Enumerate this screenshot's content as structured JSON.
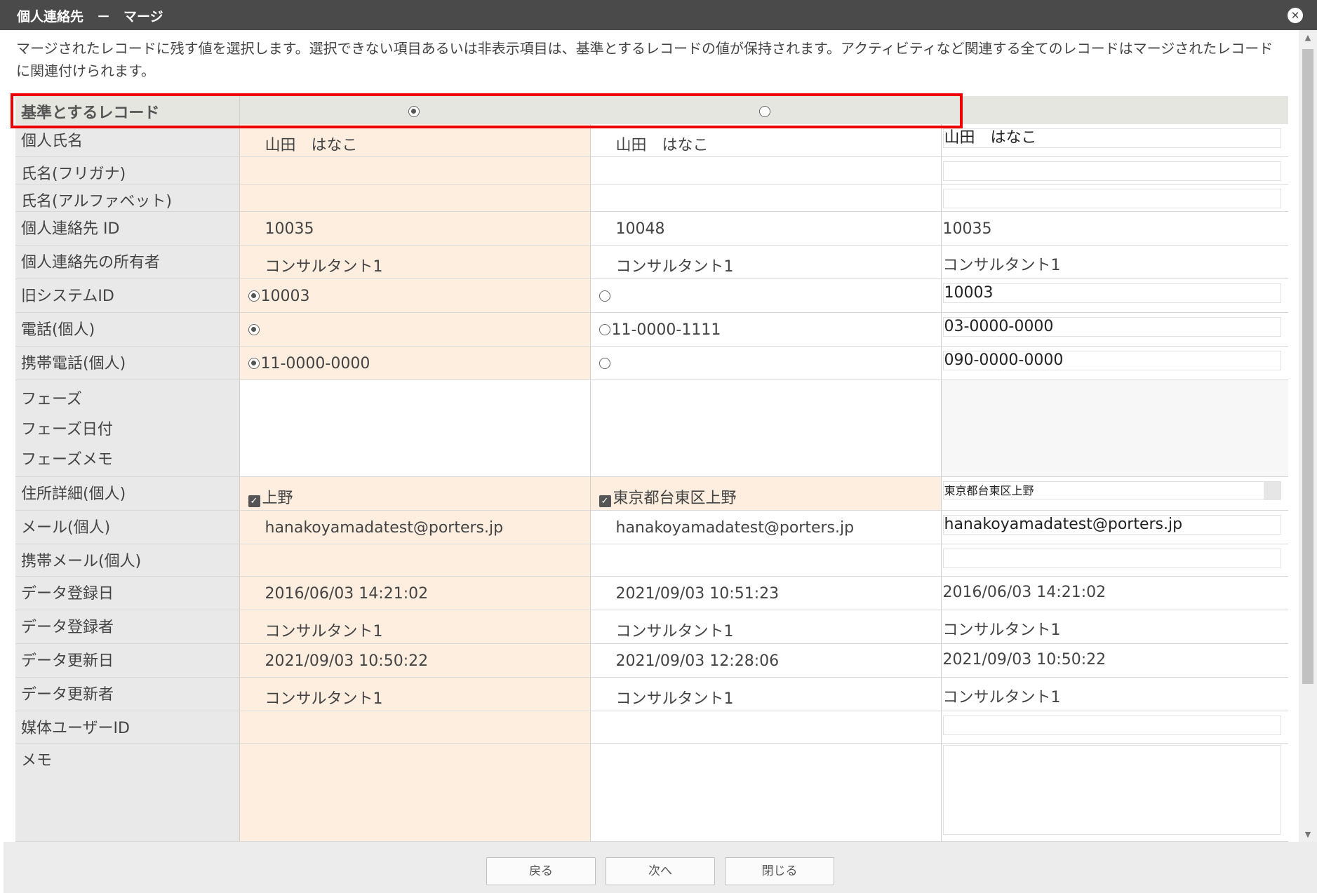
{
  "window": {
    "title": "個人連絡先　－　マージ",
    "close_glyph": "✕"
  },
  "description": "マージされたレコードに残す値を選択します。選択できない項目あるいは非表示項目は、基準とするレコードの値が保持されます。アクティビティなど関連する全てのレコードはマージされたレコードに関連付けられます。",
  "base_row": {
    "label": "基準とするレコード",
    "selected": "record1"
  },
  "rows": {
    "name": {
      "label": "個人氏名",
      "r1": "山田　はなこ",
      "r2": "山田　はなこ",
      "result": "山田　はなこ"
    },
    "kana": {
      "label": "氏名(フリガナ)",
      "r1": "",
      "r2": "",
      "result": ""
    },
    "alpha": {
      "label": "氏名(アルファベット)",
      "r1": "",
      "r2": "",
      "result": ""
    },
    "contact_id": {
      "label": "個人連絡先 ID",
      "r1": "10035",
      "r2": "10048",
      "result": "10035"
    },
    "owner": {
      "label": "個人連絡先の所有者",
      "r1": "コンサルタント1",
      "r2": "コンサルタント1",
      "result": "コンサルタント1"
    },
    "old_id": {
      "label": "旧システムID",
      "r1": "10003",
      "r2": "",
      "result": "10003"
    },
    "phone": {
      "label": "電話(個人)",
      "r1": "",
      "r2": "11-0000-1111",
      "result": "03-0000-0000"
    },
    "mobile": {
      "label": "携帯電話(個人)",
      "r1": "11-0000-0000",
      "r2": "",
      "result": "090-0000-0000"
    },
    "phase": {
      "label": "フェーズ",
      "label2": "フェーズ日付",
      "label3": "フェーズメモ"
    },
    "address": {
      "label": "住所詳細(個人)",
      "r1": "上野",
      "r2": "東京都台東区上野",
      "result": "東京都台東区上野"
    },
    "email": {
      "label": "メール(個人)",
      "r1": "hanakoyamadatest@porters.jp",
      "r2": "hanakoyamadatest@porters.jp",
      "result": "hanakoyamadatest@porters.jp"
    },
    "mobile_mail": {
      "label": "携帯メール(個人)",
      "r1": "",
      "r2": "",
      "result": ""
    },
    "created": {
      "label": "データ登録日",
      "r1": "2016/06/03 14:21:02",
      "r2": "2021/09/03 10:51:23",
      "result": "2016/06/03 14:21:02"
    },
    "creator": {
      "label": "データ登録者",
      "r1": "コンサルタント1",
      "r2": "コンサルタント1",
      "result": "コンサルタント1"
    },
    "updated": {
      "label": "データ更新日",
      "r1": "2021/09/03 10:50:22",
      "r2": "2021/09/03 12:28:06",
      "result": "2021/09/03 10:50:22"
    },
    "updater": {
      "label": "データ更新者",
      "r1": "コンサルタント1",
      "r2": "コンサルタント1",
      "result": "コンサルタント1"
    },
    "media_user": {
      "label": "媒体ユーザーID",
      "r1": "",
      "r2": "",
      "result": ""
    },
    "memo": {
      "label": "メモ"
    }
  },
  "buttons": {
    "back": "戻る",
    "next": "次へ",
    "close": "閉じる"
  },
  "scroll": {
    "up": "▲",
    "down": "▼"
  },
  "colors": {
    "titlebar": "#4a4a4a",
    "selected_column": "#fdeee0",
    "highlight": "#e00000"
  }
}
